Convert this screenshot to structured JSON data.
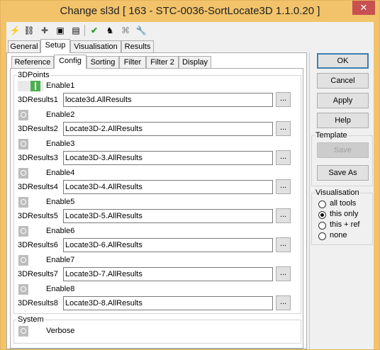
{
  "window": {
    "title": "Change sl3d [ 163 - STC-0036-SortLocate3D 1.1.0.20 ]",
    "close_label": "✕"
  },
  "toolbar": {
    "icons": [
      "lightning-icon",
      "link-icon",
      "puzzle-icon",
      "console-icon",
      "notepad-icon",
      "checkmark-icon",
      "run-person-icon",
      "network-icon",
      "wrench-icon"
    ]
  },
  "tabs_top": [
    "General",
    "Setup",
    "Visualisation",
    "Results"
  ],
  "tabs_sub": [
    "Reference",
    "Config",
    "Sorting",
    "Filter",
    "Filter 2",
    "Display"
  ],
  "points_group": {
    "title": "3DPoints",
    "rows": [
      {
        "enable_label": "Enable1",
        "enabled": true,
        "result_label": "3DResults1",
        "value": "locate3d.AllResults"
      },
      {
        "enable_label": "Enable2",
        "enabled": false,
        "result_label": "3DResults2",
        "value": "Locate3D-2.AllResults"
      },
      {
        "enable_label": "Enable3",
        "enabled": false,
        "result_label": "3DResults3",
        "value": "Locate3D-3.AllResults"
      },
      {
        "enable_label": "Enable4",
        "enabled": false,
        "result_label": "3DResults4",
        "value": "Locate3D-4.AllResults"
      },
      {
        "enable_label": "Enable5",
        "enabled": false,
        "result_label": "3DResults5",
        "value": "Locate3D-5.AllResults"
      },
      {
        "enable_label": "Enable6",
        "enabled": false,
        "result_label": "3DResults6",
        "value": "Locate3D-6.AllResults"
      },
      {
        "enable_label": "Enable7",
        "enabled": false,
        "result_label": "3DResults7",
        "value": "Locate3D-7.AllResults"
      },
      {
        "enable_label": "Enable8",
        "enabled": false,
        "result_label": "3DResults8",
        "value": "Locate3D-8.AllResults"
      }
    ],
    "browse_label": "..."
  },
  "system_group": {
    "title": "System",
    "verbose_label": "Verbose",
    "verbose_enabled": false
  },
  "buttons": {
    "ok": "OK",
    "cancel": "Cancel",
    "apply": "Apply",
    "help": "Help"
  },
  "template_group": {
    "title": "Template",
    "save": "Save",
    "save_as": "Save As"
  },
  "visualisation_group": {
    "title": "Visualisation",
    "options": [
      "all tools",
      "this only",
      "this + ref",
      "none"
    ],
    "selected": "this only"
  },
  "colors": {
    "title_bar": "#f2c36a",
    "toggle_on": "#4caf50",
    "close_button": "#c75050"
  }
}
